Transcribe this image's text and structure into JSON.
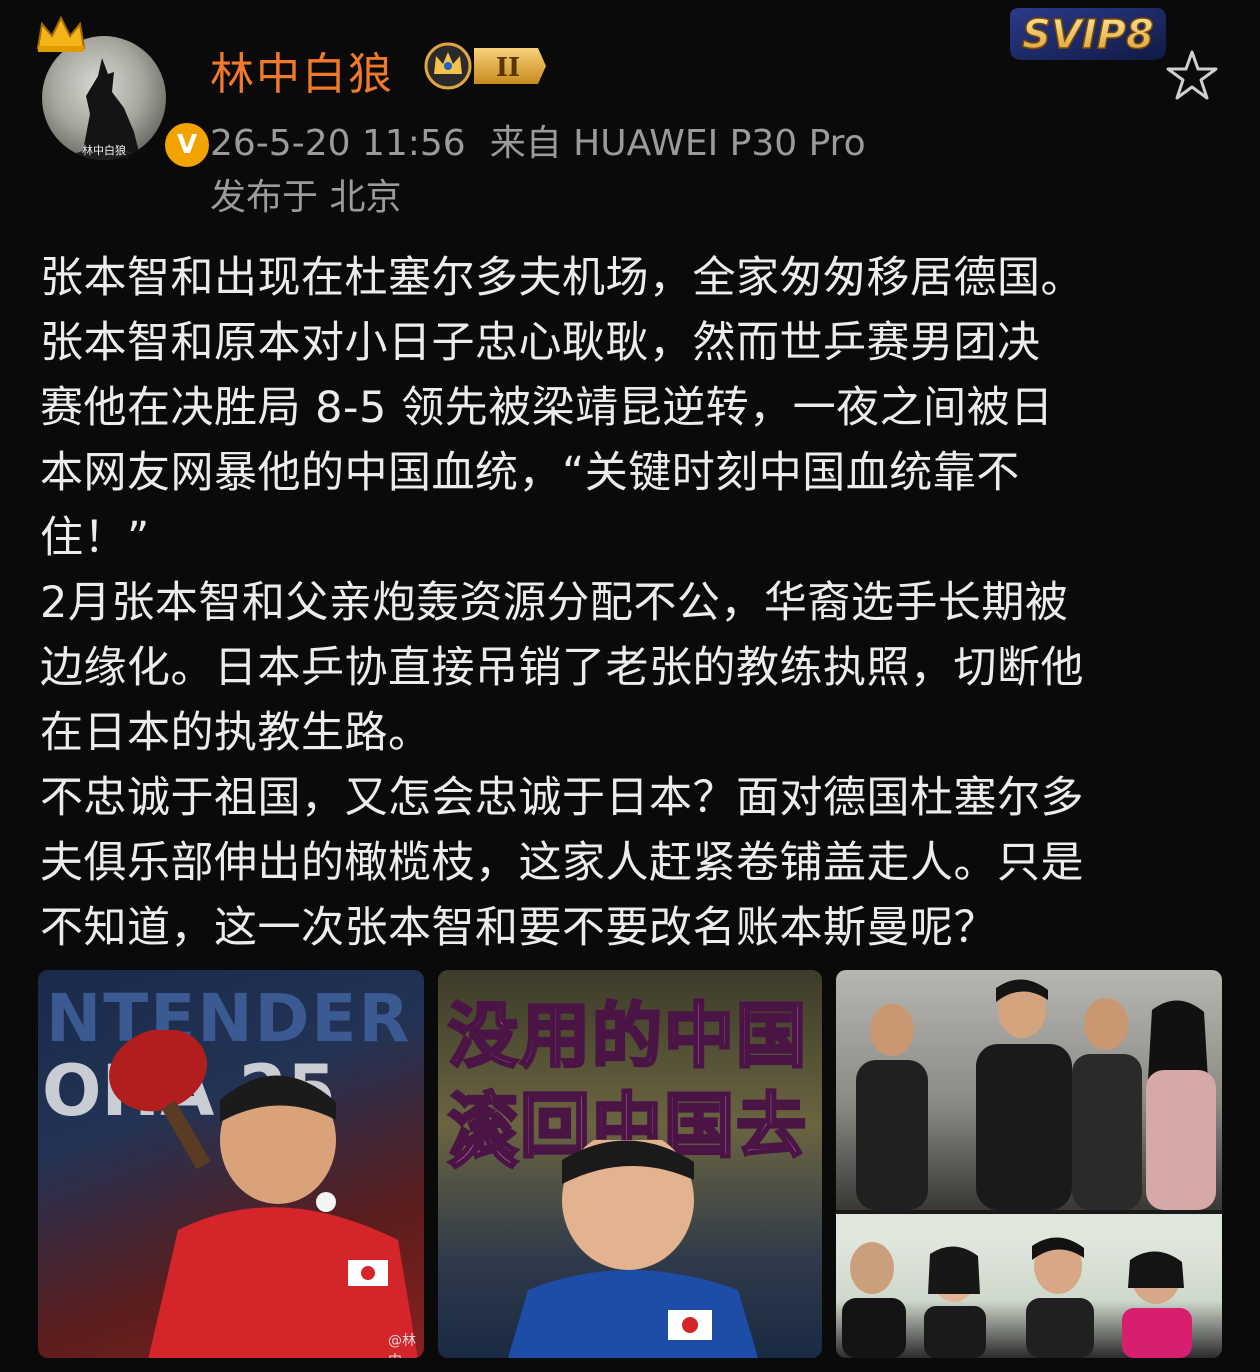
{
  "post": {
    "username": "林中白狼",
    "rank_badge": "II",
    "svip_badge": "SVIP8",
    "verified_badge": "V",
    "avatar_text": "林中白狼",
    "timestamp": "26-5-20 11:56",
    "source": "来自 HUAWEI P30 Pro",
    "location": "发布于 北京",
    "content_lines": [
      "张本智和出现在杜塞尔多夫机场，全家匆匆移居德国。",
      "张本智和原本对小日子忠心耿耿，然而世乒赛男团决",
      "赛他在决胜局 8-5 领先被梁靖昆逆转，一夜之间被日",
      "本网友网暴他的中国血统，“关键时刻中国血统靠不",
      "住！”",
      "2月张本智和父亲炮轰资源分配不公，华裔选手长期被",
      "边缘化。日本乒协直接吊销了老张的教练执照，切断他",
      "在日本的执教生路。",
      "不忠诚于祖国，又怎会忠诚于日本？面对德国杜塞尔多",
      "夫俱乐部伸出的橄榄枝，这家人赶紧卷铺盖走人。只是",
      "不知道，这一次张本智和要不要改名账本斯曼呢？"
    ]
  },
  "images": {
    "image1": {
      "line1": "NTENDER",
      "line2": "OHA 25",
      "watermark": "@林中"
    },
    "image2": {
      "line1": "没用的中国人",
      "line2": "滚回中国去"
    }
  },
  "colors": {
    "background": "#0a0a0a",
    "username": "#f07a2a",
    "meta": "#9b9b9b",
    "text": "#ececec",
    "verified": "#f2a300"
  },
  "icons": [
    "crown-icon",
    "verified-v-icon",
    "rank-crown-badge",
    "svip8-badge",
    "star-favorite-icon"
  ]
}
